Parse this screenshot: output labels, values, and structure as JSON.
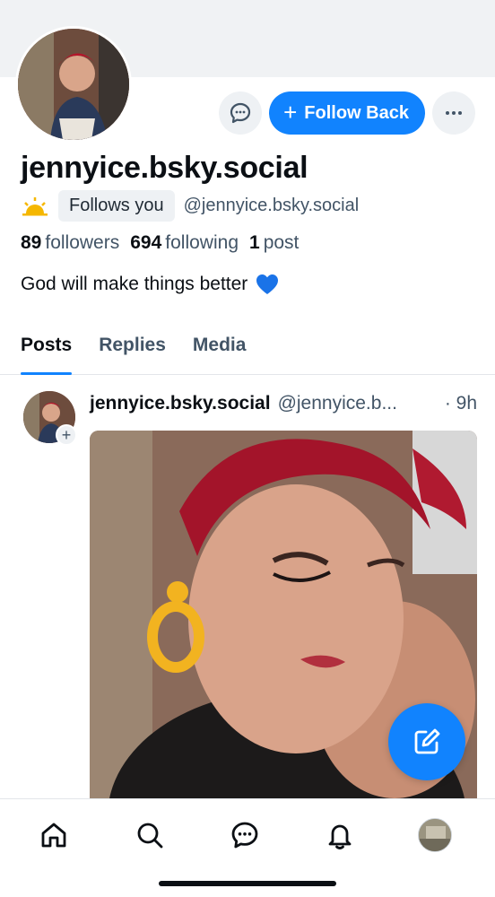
{
  "profile": {
    "handle_title": "jennyice.bsky.social",
    "follows_you": "Follows you",
    "handle": "@jennyice.bsky.social",
    "followers_count": "89",
    "followers_label": "followers",
    "following_count": "694",
    "following_label": "following",
    "posts_count": "1",
    "posts_label": "post",
    "bio": "God will make things better",
    "bio_emoji": "💙",
    "status_emoji": "sun-icon"
  },
  "actions": {
    "follow_label": "Follow Back",
    "message_icon": "chat-bubble-icon",
    "more_icon": "more-dots-icon"
  },
  "tabs": [
    {
      "label": "Posts",
      "active": true
    },
    {
      "label": "Replies",
      "active": false
    },
    {
      "label": "Media",
      "active": false
    }
  ],
  "post": {
    "author": "jennyice.bsky.social",
    "handle": "@jennyice.b...",
    "time": "· 9h"
  },
  "nav": [
    "home-icon",
    "search-icon",
    "chat-icon",
    "bell-icon",
    "profile-avatar"
  ],
  "colors": {
    "accent": "#1183fe",
    "muted_text": "#425466",
    "pill_bg": "#eef1f4",
    "heart": "#1a73e8"
  }
}
